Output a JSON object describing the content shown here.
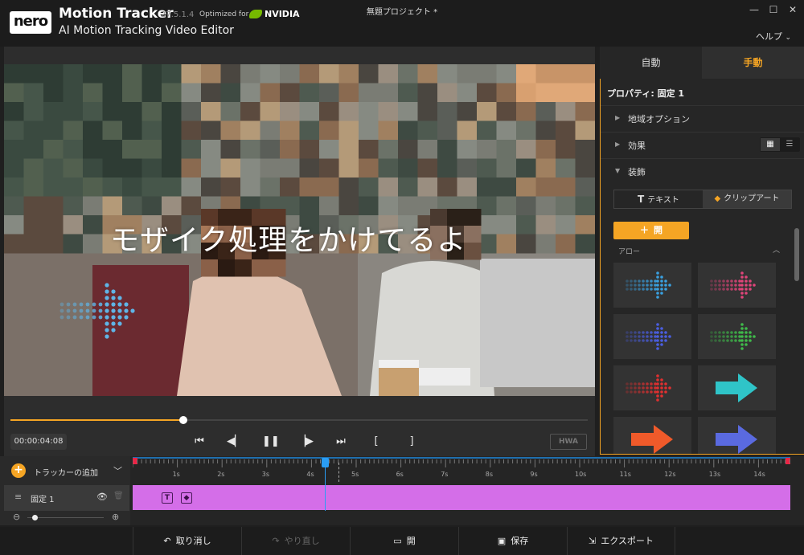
{
  "app": {
    "logo": "nero",
    "name": "Motion Tracker",
    "version": "27.5.1.4",
    "optimized_for": "Optimized for",
    "nvidia": "NVIDIA",
    "subtitle": "AI Motion Tracking Video Editor",
    "document_title": "無題プロジェクト *",
    "help": "ヘルプ"
  },
  "window_controls": {
    "minimize": "—",
    "maximize": "☐",
    "close": "✕"
  },
  "video": {
    "caption": "モザイク処理をかけてるよ",
    "timecode": "00:00:04:08",
    "progress": 0.3,
    "hwa": "HWA"
  },
  "right_panel": {
    "tabs": {
      "auto": "自動",
      "manual": "手動"
    },
    "properties_title": "プロパティ: 固定 1",
    "sections": [
      "地域オプション",
      "効果",
      "装飾"
    ],
    "subtabs": {
      "text": "テキスト",
      "clipart": "クリップアート"
    },
    "open_button": "開",
    "arrow_category": "アロー",
    "arrow_thumbs": [
      {
        "color": "#3aa0e0",
        "style": "dotted"
      },
      {
        "color": "#e0457a",
        "style": "dotted"
      },
      {
        "color": "#4a5ee0",
        "style": "dotted"
      },
      {
        "color": "#3fb94a",
        "style": "dotted"
      },
      {
        "color": "#e03030",
        "style": "dotted"
      },
      {
        "color": "#2fc4c8",
        "style": "solid"
      },
      {
        "color": "#f05a2a",
        "style": "solid"
      },
      {
        "color": "#5a6ae0",
        "style": "solid"
      }
    ]
  },
  "timeline": {
    "add_tracker": "トラッカーの追加",
    "track_name": "固定 1",
    "ticks": [
      "1s",
      "2s",
      "3s",
      "4s",
      "5s",
      "6s",
      "7s",
      "8s",
      "9s",
      "10s",
      "11s",
      "12s",
      "13s",
      "14s"
    ],
    "playhead_seconds": 4.3,
    "clip_color": "#d46ee8"
  },
  "toolbar": {
    "undo": "取り消し",
    "redo": "やり直し",
    "open": "開",
    "save": "保存",
    "export": "エクスポート"
  },
  "colors": {
    "accent": "#f5a524",
    "playhead": "#2a9df4"
  }
}
